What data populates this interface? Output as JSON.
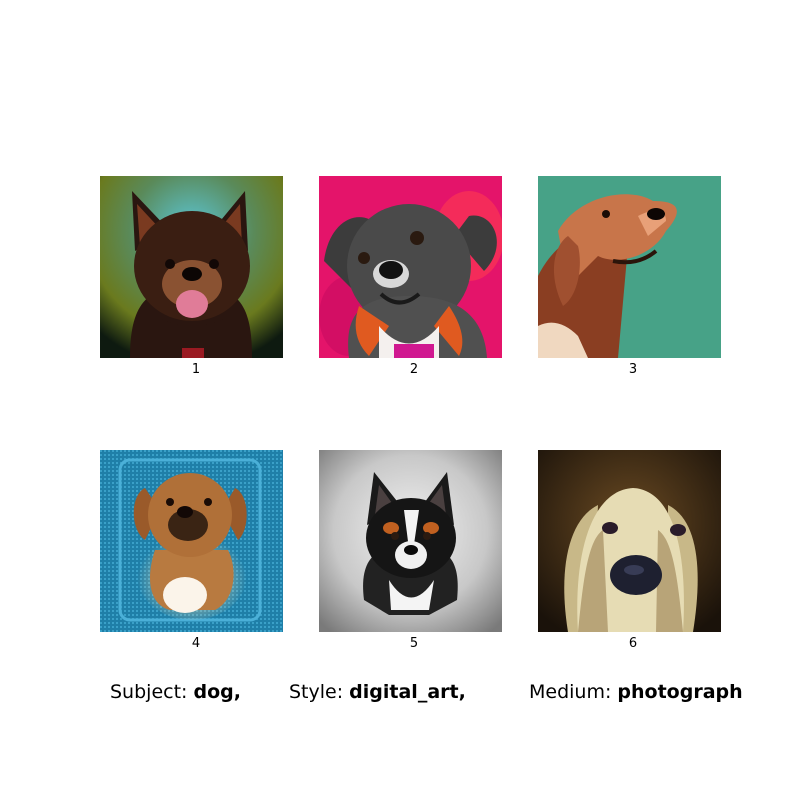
{
  "grid": {
    "images": [
      {
        "number": "1",
        "description": "black and tan fluffy dog with tongue out on teal-to-green background"
      },
      {
        "number": "2",
        "description": "grey black and orange dog with white chest on magenta background"
      },
      {
        "number": "3",
        "description": "golden retriever head in profile on teal green background"
      },
      {
        "number": "4",
        "description": "tan pug mix portrait on blue textured background"
      },
      {
        "number": "5",
        "description": "black white and tan dog portrait on grey vignette background"
      },
      {
        "number": "6",
        "description": "cream basset-like dog close up with dark nose on dark brown background"
      }
    ]
  },
  "captions": {
    "subject_label": "Subject:",
    "subject_value": "dog,",
    "style_label": "Style:",
    "style_value": "digital_art,",
    "medium_label": "Medium:",
    "medium_value": "photograph"
  }
}
